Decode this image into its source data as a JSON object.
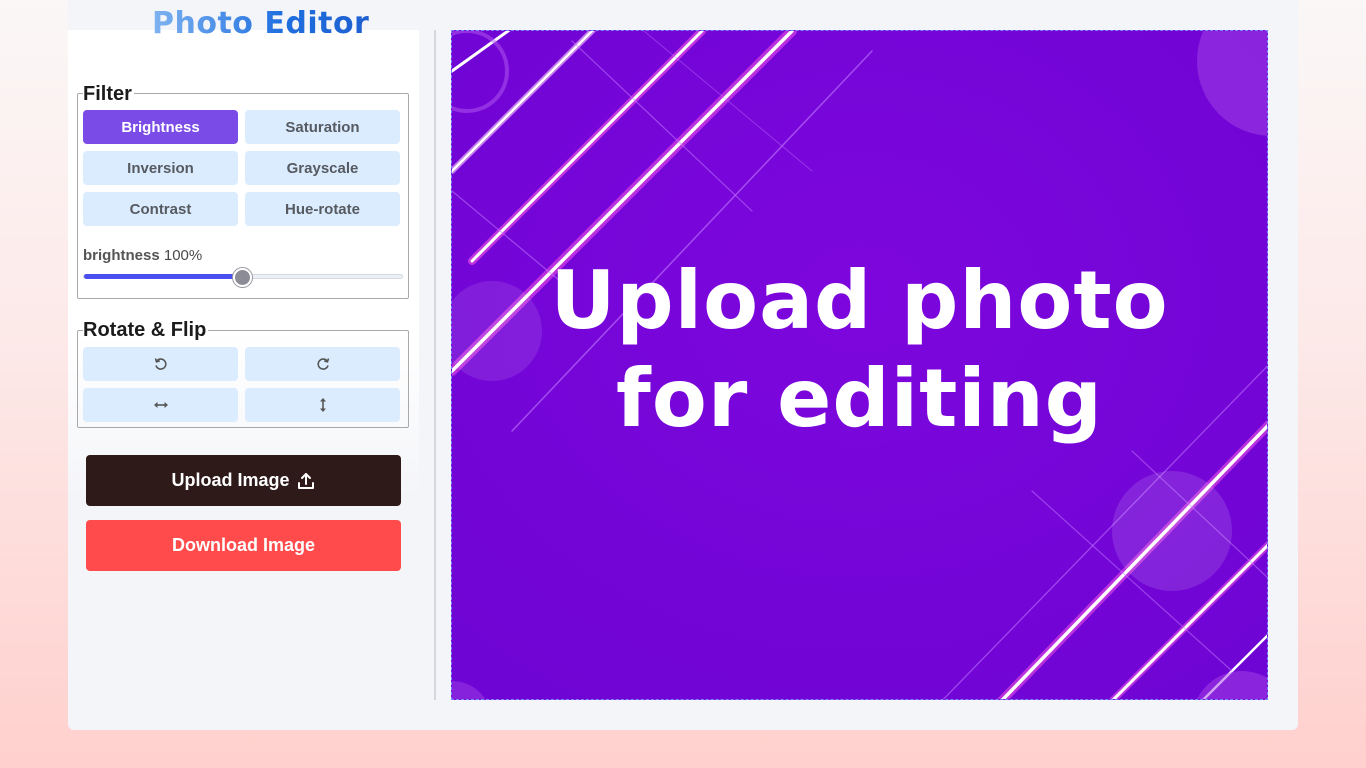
{
  "app": {
    "title": "Photo Editor"
  },
  "filter": {
    "legend": "Filter",
    "buttons": [
      "Brightness",
      "Saturation",
      "Inversion",
      "Grayscale",
      "Contrast",
      "Hue-rotate"
    ],
    "active": "Brightness",
    "slider": {
      "name": "brightness",
      "value_text": "100%",
      "value": 100,
      "max": 200
    }
  },
  "rotate_flip": {
    "legend": "Rotate & Flip",
    "icons": [
      "rotate-left-icon",
      "rotate-right-icon",
      "flip-horizontal-icon",
      "flip-vertical-icon"
    ]
  },
  "actions": {
    "upload_label": "Upload Image",
    "download_label": "Download Image"
  },
  "preview": {
    "line1": "Upload photo",
    "line2": "for editing"
  },
  "colors": {
    "accent": "#7a4be6",
    "upload_bg": "#2e1a19",
    "download_bg": "#ff4b4b",
    "preview_bg": "#7a07dc"
  }
}
